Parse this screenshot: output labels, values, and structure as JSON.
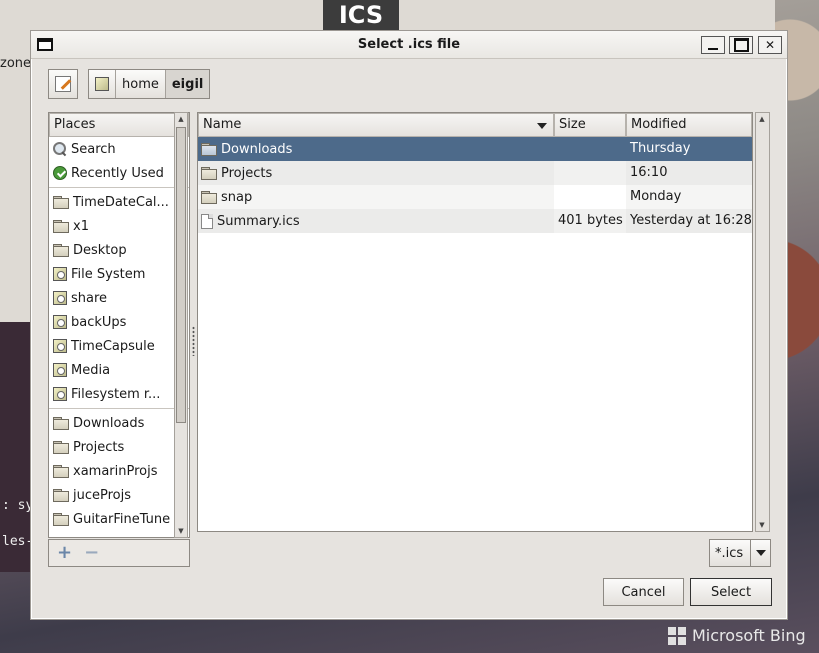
{
  "background": {
    "logo_text": "ICS",
    "window_fragment_text": "zone",
    "terminal_lines": [
      ": sy",
      "les-"
    ],
    "watermark": "Microsoft Bing"
  },
  "dialog": {
    "title": "Select .ics file",
    "path": [
      "home",
      "eigil"
    ],
    "places_header": "Places",
    "places": [
      {
        "label": "Search",
        "icon": "search-icon"
      },
      {
        "label": "Recently Used",
        "icon": "clock-icon"
      },
      {
        "separator": true
      },
      {
        "label": "TimeDateCal...",
        "icon": "folder-icon"
      },
      {
        "label": "x1",
        "icon": "folder-icon"
      },
      {
        "label": "Desktop",
        "icon": "folder-icon"
      },
      {
        "label": "File System",
        "icon": "drive-icon"
      },
      {
        "label": "share",
        "icon": "drive-icon"
      },
      {
        "label": "backUps",
        "icon": "drive-icon"
      },
      {
        "label": "TimeCapsule",
        "icon": "drive-icon"
      },
      {
        "label": "Media",
        "icon": "drive-icon"
      },
      {
        "label": "Filesystem r...",
        "icon": "drive-icon"
      },
      {
        "separator": true
      },
      {
        "label": "Downloads",
        "icon": "folder-icon"
      },
      {
        "label": "Projects",
        "icon": "folder-icon"
      },
      {
        "label": "xamarinProjs",
        "icon": "folder-icon"
      },
      {
        "label": "juceProjs",
        "icon": "folder-icon"
      },
      {
        "label": "GuitarFineTune",
        "icon": "folder-icon"
      }
    ],
    "columns": {
      "name": "Name",
      "size": "Size",
      "modified": "Modified"
    },
    "files": [
      {
        "name": "Downloads",
        "size": "",
        "modified": "Thursday",
        "type": "folder",
        "selected": true
      },
      {
        "name": "Projects",
        "size": "",
        "modified": "16:10",
        "type": "folder",
        "selected": false
      },
      {
        "name": "snap",
        "size": "",
        "modified": "Monday",
        "type": "folder",
        "selected": false
      },
      {
        "name": "Summary.ics",
        "size": "401 bytes",
        "modified": "Yesterday at 16:28",
        "type": "file",
        "selected": false
      }
    ],
    "filter": "*.ics",
    "buttons": {
      "cancel": "Cancel",
      "select": "Select"
    },
    "accent_selection": "#4d6a8a"
  }
}
